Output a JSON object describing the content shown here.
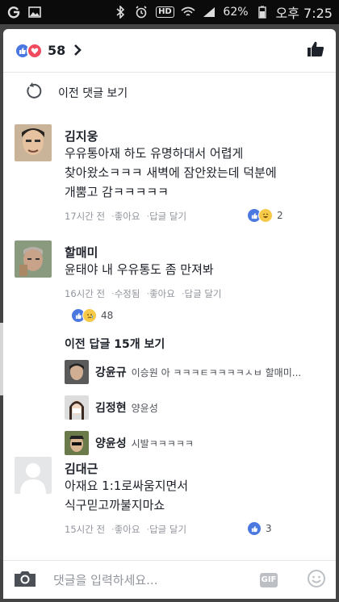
{
  "status_bar": {
    "battery_percent": "62%",
    "time": "오후 7:25",
    "hd_label": "HD"
  },
  "reactions": {
    "count": "58"
  },
  "prev_comments_label": "이전 댓글 보기",
  "comments": [
    {
      "name": "김지웅",
      "text_lines": [
        "우유통아재 하도 유명하대서 어렵게",
        "찾아왔소ㅋㅋㅋ 새벽에 잠안왔는데 덕분에",
        "개뿜고 감ㅋㅋㅋㅋㅋ"
      ],
      "time": "17시간 전",
      "like": "좋아요",
      "reply": "답글 달기",
      "reaction_count": "2"
    },
    {
      "name": "할매미",
      "text_lines": [
        "윤태야 내 우유통도 좀 만져봐"
      ],
      "time": "16시간 전",
      "edited": "수정됨",
      "like": "좋아요",
      "reply": "답글 달기",
      "reaction_count": "48",
      "view_replies": "이전 답글 15개 보기",
      "replies": [
        {
          "name": "강윤규",
          "text": "이승원 아 ㅋㅋㅋㅌㅋㅋㅋㅋㅅㅂ 할매미..."
        },
        {
          "name": "김정현",
          "text": "양윤성"
        },
        {
          "name": "양윤성",
          "text": "시발ㅋㅋㅋㅋㅋ"
        }
      ]
    },
    {
      "name": "김대근",
      "text_lines": [
        "아재요 1:1로싸움지면서",
        "식구믿고까불지마쇼"
      ],
      "time": "15시간 전",
      "like": "좋아요",
      "reply": "답글 달기",
      "reaction_count": "3"
    }
  ],
  "input": {
    "placeholder": "댓글을 입력하세요...",
    "gif_label": "GIF"
  },
  "colors": {
    "like_blue": "#4a78e0",
    "love_red": "#f04a5e",
    "meta_gray": "#90949c"
  }
}
